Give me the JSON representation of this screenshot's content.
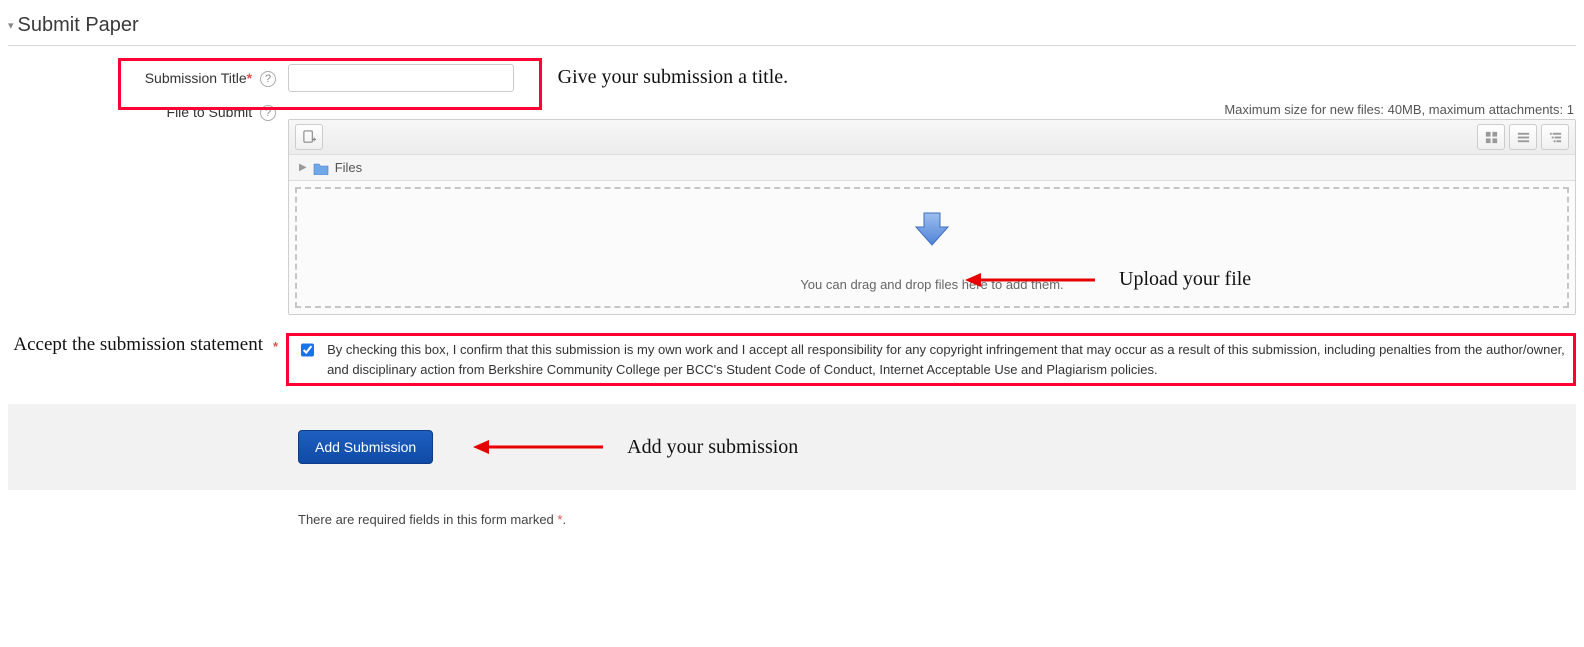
{
  "section": {
    "title": "Submit Paper"
  },
  "title_row": {
    "label": "Submission Title",
    "value": "",
    "placeholder": ""
  },
  "annotations": {
    "title_hint": "Give your submission a title.",
    "upload_hint": "Upload your file",
    "statement_hint": "Accept the submission statement",
    "add_hint": "Add your submission"
  },
  "file_row": {
    "label": "File to Submit",
    "info": "Maximum size for new files: 40MB, maximum attachments: 1",
    "breadcrumb": "Files",
    "drop_text": "You can drag and drop files here to add them."
  },
  "statement": {
    "checked": true,
    "text": "By checking this box, I confirm that this submission is my own work and I accept all responsibility for any copyright infringement that may occur as a result of this submission, including penalties from the author/owner, and disciplinary action from Berkshire Community College per BCC's Student Code of Conduct, Internet Acceptable Use and Plagiarism policies."
  },
  "submit": {
    "button_label": "Add Submission"
  },
  "req_note": {
    "text_prefix": "There are required fields in this form marked ",
    "marker": "*",
    "text_suffix": "."
  }
}
